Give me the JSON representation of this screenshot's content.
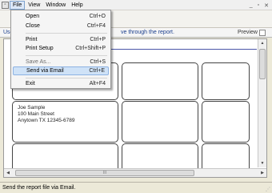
{
  "menubar": {
    "items": [
      "File",
      "View",
      "Window",
      "Help"
    ],
    "window_controls": [
      "minimize-icon",
      "restore-icon",
      "close-icon"
    ]
  },
  "infobar": {
    "left_text": "Use",
    "right_text": "ve through the report.",
    "preview_label": "Preview",
    "preview_checked": false
  },
  "file_menu": {
    "open": {
      "label": "Open",
      "shortcut": "Ctrl+O"
    },
    "close": {
      "label": "Close",
      "shortcut": "Ctrl+F4"
    },
    "print": {
      "label": "Print",
      "shortcut": "Ctrl+P"
    },
    "print_setup": {
      "label": "Print Setup",
      "shortcut": "Ctrl+Shift+P"
    },
    "save_as": {
      "label": "Save As...",
      "shortcut": "Ctrl+S"
    },
    "send_email": {
      "label": "Send via Email",
      "shortcut": "Ctrl+E"
    },
    "exit": {
      "label": "Exit",
      "shortcut": "Alt+F4"
    }
  },
  "report": {
    "address": {
      "line1": "Joe Sample",
      "line2": "100 Main Street",
      "line3": "Anytown TX 12345-6789"
    }
  },
  "scrollbar": {
    "thumb_label": "III"
  },
  "statusbar": {
    "text": "Send the report file via Email."
  }
}
